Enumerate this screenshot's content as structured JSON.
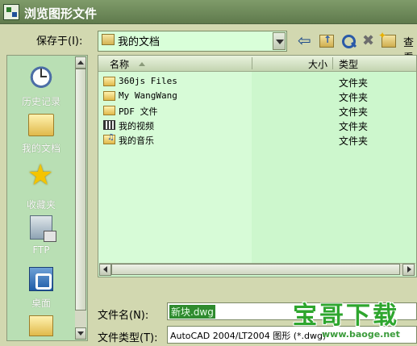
{
  "window": {
    "title": "浏览图形文件"
  },
  "save_in": {
    "label": "保存于(I):",
    "value": "我的文档"
  },
  "toolbar": {
    "view_label": "查看"
  },
  "places": [
    {
      "label": "历史记录",
      "icon": "history-icon"
    },
    {
      "label": "我的文档",
      "icon": "my-documents-icon"
    },
    {
      "label": "收藏夹",
      "icon": "favorites-icon"
    },
    {
      "label": "FTP",
      "icon": "ftp-icon"
    },
    {
      "label": "桌面",
      "icon": "desktop-icon"
    }
  ],
  "file_list": {
    "columns": {
      "name": "名称",
      "size": "大小",
      "type": "类型"
    },
    "rows": [
      {
        "name": "360js Files",
        "type": "文件夹",
        "icon": "folder-icon"
      },
      {
        "name": "My WangWang",
        "type": "文件夹",
        "icon": "folder-icon"
      },
      {
        "name": "PDF 文件",
        "type": "文件夹",
        "icon": "folder-icon"
      },
      {
        "name": "我的视频",
        "type": "文件夹",
        "icon": "video-folder-icon"
      },
      {
        "name": "我的音乐",
        "type": "文件夹",
        "icon": "music-folder-icon"
      }
    ]
  },
  "file_name": {
    "label": "文件名(N):",
    "value": "新块.dwg"
  },
  "file_type": {
    "label": "文件类型(T):",
    "value": "AutoCAD 2004/LT2004 图形 (*.dwg)"
  },
  "watermark": {
    "title": "宝哥下载",
    "url": "www.baoge.net"
  },
  "colors": {
    "titlebar": "#5f7a4c",
    "list_bg": "#cdf7cd",
    "places_bg": "#b9dfb4",
    "dialog_bg": "#d2d8b0"
  }
}
